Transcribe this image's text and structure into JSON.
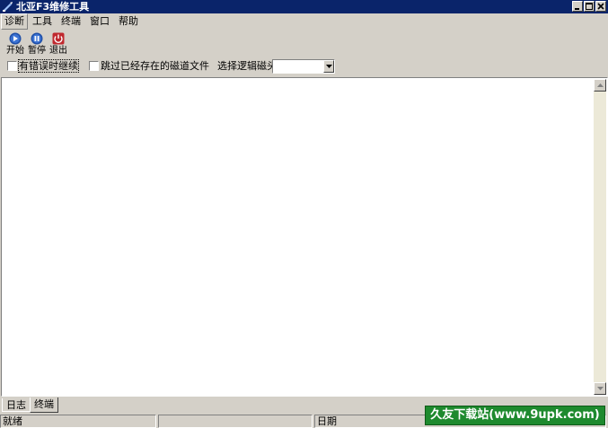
{
  "window": {
    "title": "北亚F3维修工具",
    "controls": [
      "minimize",
      "maximize",
      "close"
    ]
  },
  "menu": {
    "items": [
      "诊断",
      "工具",
      "终端",
      "窗口",
      "帮助"
    ]
  },
  "toolbar": {
    "buttons": [
      {
        "label": "开始",
        "icon": "play-icon",
        "color": "#1f4fa8"
      },
      {
        "label": "暂停",
        "icon": "pause-icon",
        "color": "#1f4fa8"
      },
      {
        "label": "退出",
        "icon": "power-icon",
        "color": "#c0282e"
      }
    ]
  },
  "options": {
    "check_retry": {
      "label": "有错误时继续",
      "checked": false
    },
    "check_skip": {
      "label": "跳过已经存在的磁道文件",
      "checked": false
    },
    "select_head_label": "选择逻辑磁头:",
    "select_head_value": ""
  },
  "tabs": {
    "items": [
      {
        "label": "日志",
        "active": false
      },
      {
        "label": "终端",
        "active": true
      }
    ]
  },
  "statusbar": {
    "status": "就绪",
    "panel2": "",
    "date_label": "日期"
  },
  "watermark": {
    "text": "久友下载站(www.9upk.com)"
  },
  "colors": {
    "titlebar": "#0a246a",
    "face": "#d4d0c8",
    "watermark": "#1e8a2e"
  }
}
